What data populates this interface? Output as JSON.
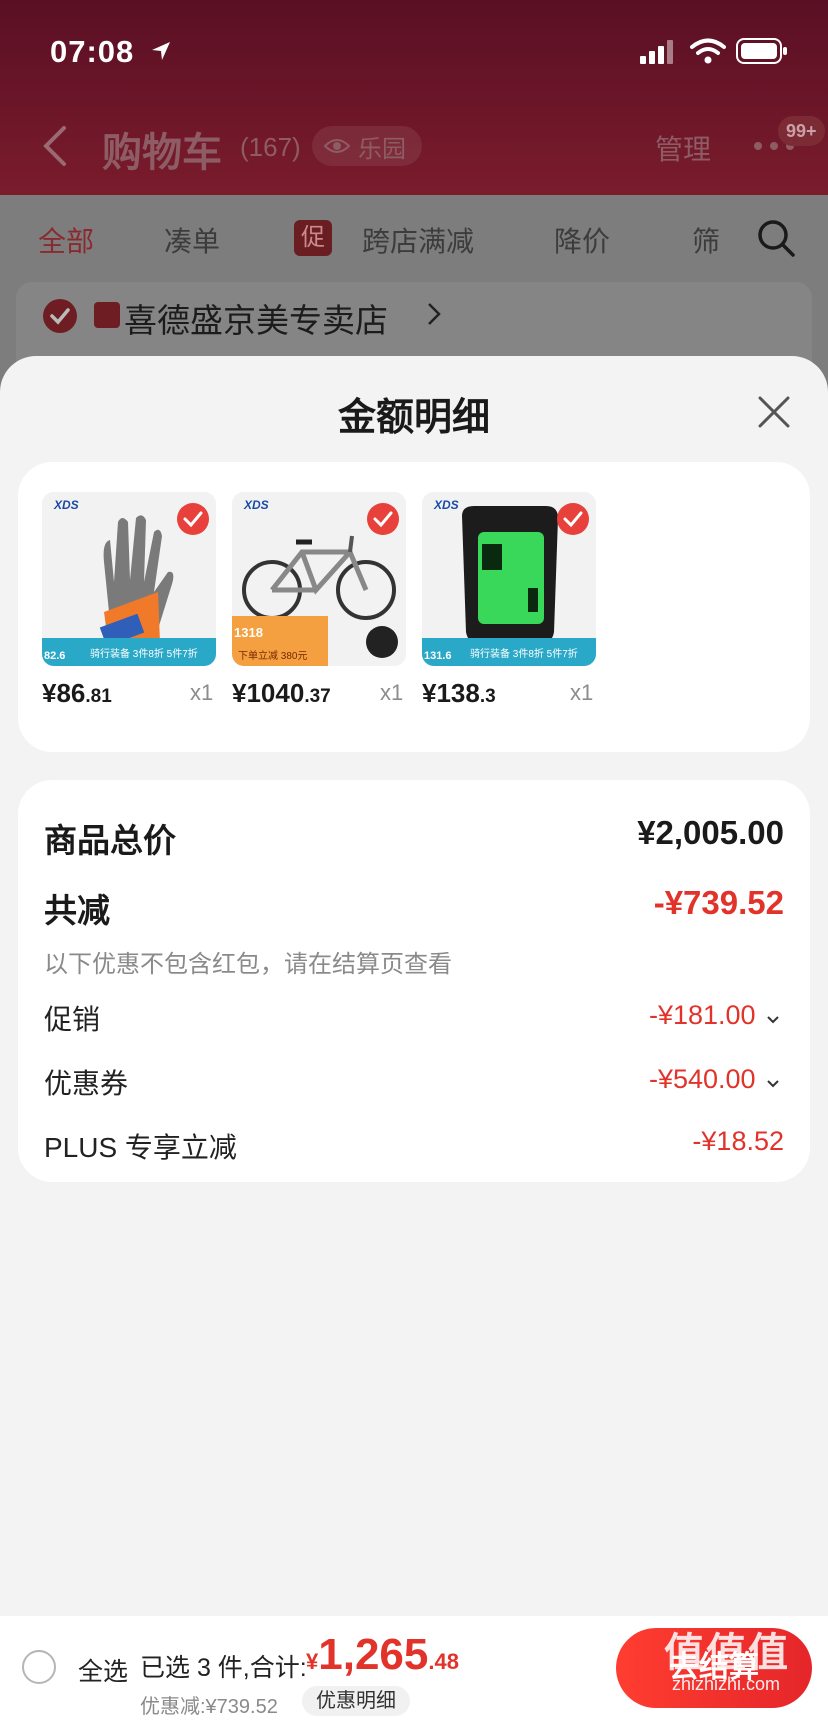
{
  "status_bar": {
    "time": "07:08"
  },
  "nav": {
    "title": "购物车",
    "count": "(167)",
    "paradise_label": "乐园",
    "manage_label": "管理",
    "message_badge": "99+"
  },
  "filter_tabs": {
    "all": "全部",
    "combine": "凑单",
    "promo_badge": "促",
    "cross_store": "跨店满减",
    "price_drop": "降价",
    "filter": "筛"
  },
  "store": {
    "name": "喜德盛京美专卖店"
  },
  "sheet": {
    "title": "金额明细",
    "products": [
      {
        "brand": "XDS",
        "strip_price": "82.6",
        "strip_text": "骑行装备 3件8折 5件7折",
        "price_int": "¥86",
        "price_dec": ".81",
        "qty": "x1"
      },
      {
        "brand": "XDS",
        "strip_price": "1318",
        "strip_text": "下单立减 380元",
        "price_int": "¥1040",
        "price_dec": ".37",
        "qty": "x1"
      },
      {
        "brand": "XDS",
        "strip_price": "131.6",
        "strip_text": "骑行装备 3件8折 5件7折",
        "price_int": "¥138",
        "price_dec": ".3",
        "qty": "x1"
      }
    ],
    "summary": {
      "total_label": "商品总价",
      "total_value": "¥2,005.00",
      "reduce_label": "共减",
      "reduce_value": "-¥739.52",
      "note": "以下优惠不包含红包，请在结算页查看",
      "promo_label": "促销",
      "promo_value": "-¥181.00",
      "coupon_label": "优惠券",
      "coupon_value": "-¥540.00",
      "plus_label": "PLUS 专享立减",
      "plus_value": "-¥18.52"
    }
  },
  "bottom_bar": {
    "select_all": "全选",
    "selected_text": "已选 3 件,合计:",
    "total_currency": "¥",
    "total_int": "1,265",
    "total_dec": ".48",
    "discount_text": "优惠减:¥739.52",
    "detail_link": "优惠明细",
    "checkout": "去结算",
    "watermark": "值值值",
    "watermark_sub": "zhizhizhi.com"
  },
  "colors": {
    "accent_red": "#e2332b",
    "header_bg": "#5a0f24"
  }
}
